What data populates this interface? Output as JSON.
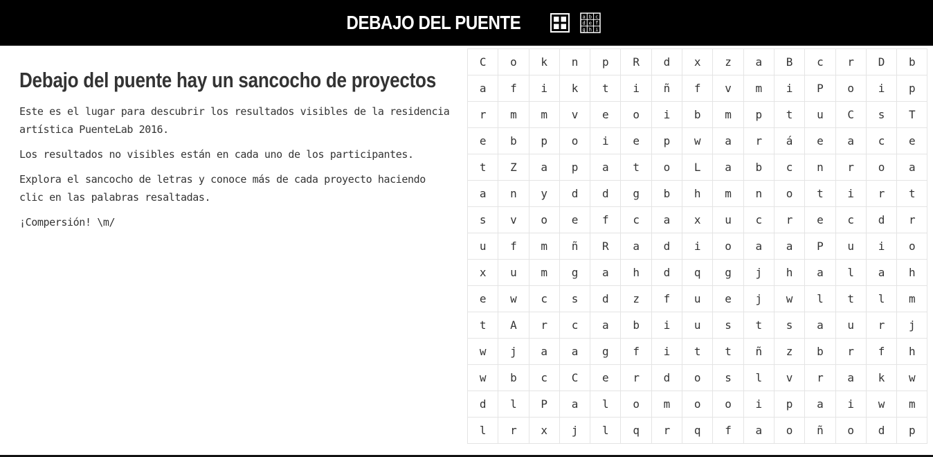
{
  "header": {
    "title": "DEBAJO DEL PUENTE",
    "icons": [
      "grid-view-icon",
      "letter-grid-icon"
    ],
    "letter_icon_rows": [
      "abc",
      "def",
      "ghi"
    ]
  },
  "intro": {
    "heading": "Debajo del puente hay un sancocho de proyectos",
    "paragraphs": [
      "Este es el lugar para descubrir los resultados visibles de la residencia artística PuenteLab 2016.",
      "Los resultados no visibles están en cada uno de los participantes.",
      "Explora el sancocho de letras y conoce más de cada proyecto haciendo clic en las palabras resaltadas.",
      "¡Compersión! \\m/"
    ]
  },
  "letter_grid": [
    [
      "C",
      "o",
      "k",
      "n",
      "p",
      "R",
      "d",
      "x",
      "z",
      "a",
      "B",
      "c",
      "r",
      "D",
      "b"
    ],
    [
      "a",
      "f",
      "i",
      "k",
      "t",
      "i",
      "ñ",
      "f",
      "v",
      "m",
      "i",
      "P",
      "o",
      "i",
      "p"
    ],
    [
      "r",
      "m",
      "m",
      "v",
      "e",
      "o",
      "i",
      "b",
      "m",
      "p",
      "t",
      "u",
      "C",
      "s",
      "T"
    ],
    [
      "e",
      "b",
      "p",
      "o",
      "i",
      "e",
      "p",
      "w",
      "a",
      "r",
      "á",
      "e",
      "a",
      "c",
      "e"
    ],
    [
      "t",
      "Z",
      "a",
      "p",
      "a",
      "t",
      "o",
      "L",
      "a",
      "b",
      "c",
      "n",
      "r",
      "o",
      "a"
    ],
    [
      "a",
      "n",
      "y",
      "d",
      "d",
      "g",
      "b",
      "h",
      "m",
      "n",
      "o",
      "t",
      "i",
      "r",
      "t"
    ],
    [
      "s",
      "v",
      "o",
      "e",
      "f",
      "c",
      "a",
      "x",
      "u",
      "c",
      "r",
      "e",
      "c",
      "d",
      "r"
    ],
    [
      "u",
      "f",
      "m",
      "ñ",
      "R",
      "a",
      "d",
      "i",
      "o",
      "a",
      "a",
      "P",
      "u",
      "i",
      "o"
    ],
    [
      "x",
      "u",
      "m",
      "g",
      "a",
      "h",
      "d",
      "q",
      "g",
      "j",
      "h",
      "a",
      "l",
      "a",
      "h"
    ],
    [
      "e",
      "w",
      "c",
      "s",
      "d",
      "z",
      "f",
      "u",
      "e",
      "j",
      "w",
      "l",
      "t",
      "l",
      "m"
    ],
    [
      "t",
      "A",
      "r",
      "c",
      "a",
      "b",
      "i",
      "u",
      "s",
      "t",
      "s",
      "a",
      "u",
      "r",
      "j"
    ],
    [
      "w",
      "j",
      "a",
      "a",
      "g",
      "f",
      "i",
      "t",
      "t",
      "ñ",
      "z",
      "b",
      "r",
      "f",
      "h"
    ],
    [
      "w",
      "b",
      "c",
      "C",
      "e",
      "r",
      "d",
      "o",
      "s",
      "l",
      "v",
      "r",
      "a",
      "k",
      "w"
    ],
    [
      "d",
      "l",
      "P",
      "a",
      "l",
      "o",
      "m",
      "o",
      "o",
      "i",
      "p",
      "a",
      "i",
      "w",
      "m"
    ],
    [
      "l",
      "r",
      "x",
      "j",
      "l",
      "q",
      "r",
      "q",
      "f",
      "a",
      "o",
      "ñ",
      "o",
      "d",
      "p"
    ]
  ]
}
